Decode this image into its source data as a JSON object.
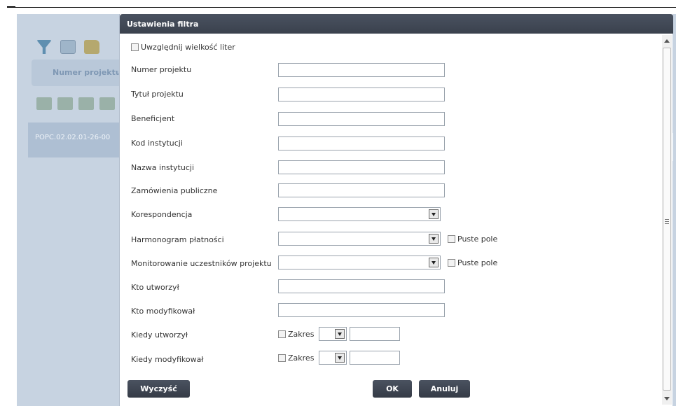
{
  "background": {
    "column_header": "Numer projektu",
    "row_text": "POPC.02.02.01-26-00"
  },
  "dialog": {
    "title": "Ustawienia filtra",
    "case_sensitive_label": "Uwzględnij wielkość liter",
    "fields": [
      {
        "label": "Numer projektu",
        "type": "text",
        "value": ""
      },
      {
        "label": "Tytuł projektu",
        "type": "text",
        "value": ""
      },
      {
        "label": "Beneficjent",
        "type": "text",
        "value": ""
      },
      {
        "label": "Kod instytucji",
        "type": "text",
        "value": ""
      },
      {
        "label": "Nazwa instytucji",
        "type": "text",
        "value": ""
      },
      {
        "label": "Zamówienia publiczne",
        "type": "text",
        "value": ""
      },
      {
        "label": "Korespondencja",
        "type": "select",
        "value": ""
      },
      {
        "label": "Harmonogram płatności",
        "type": "select",
        "value": "",
        "empty_label": "Puste pole"
      },
      {
        "label": "Monitorowanie uczestników projektu",
        "type": "select",
        "value": "",
        "empty_label": "Puste pole"
      },
      {
        "label": "Kto utworzył",
        "type": "text",
        "value": ""
      },
      {
        "label": "Kto modyfikował",
        "type": "text",
        "value": ""
      },
      {
        "label": "Kiedy utworzył",
        "type": "range",
        "range_label": "Zakres"
      },
      {
        "label": "Kiedy modyfikował",
        "type": "range",
        "range_label": "Zakres"
      }
    ],
    "buttons": {
      "clear": "Wyczyść",
      "ok": "OK",
      "cancel": "Anuluj"
    }
  },
  "colors": {
    "title_bar": "#3f4653",
    "overlay": "#c7d3e1"
  }
}
